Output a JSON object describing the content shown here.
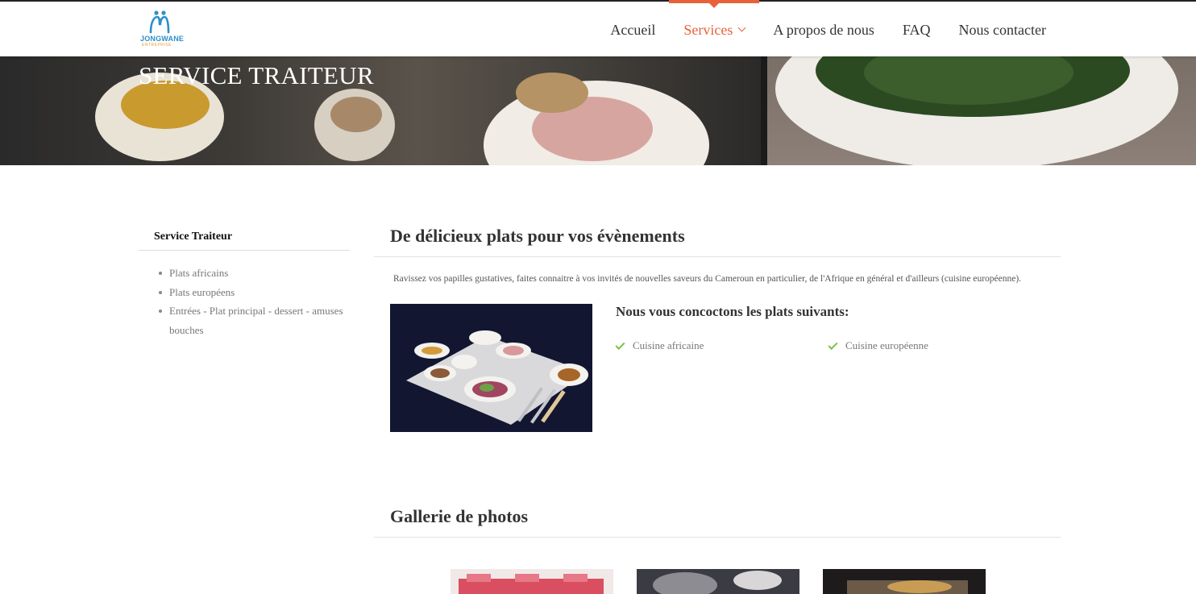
{
  "brand": {
    "name": "JONGWANE",
    "tagline": "ENTREPRISE",
    "primary_color": "#2c8fc9",
    "accent_color": "#e8613a"
  },
  "nav": {
    "items": [
      {
        "label": "Accueil",
        "active": false
      },
      {
        "label": "Services",
        "active": true,
        "has_dropdown": true
      },
      {
        "label": "A propos de nous",
        "active": false
      },
      {
        "label": "FAQ",
        "active": false
      },
      {
        "label": "Nous contacter",
        "active": false
      }
    ]
  },
  "banner": {
    "title": "SERVICE TRAITEUR"
  },
  "sidebar": {
    "title": "Service Traiteur",
    "items": [
      "Plats africains",
      "Plats européens",
      "Entrées - Plat principal - dessert - amuses bouches"
    ]
  },
  "main": {
    "heading": "De délicieux plats pour vos évènements",
    "intro": "Ravissez vos papilles gustatives, faites connaitre à vos invités de nouvelles saveurs du Cameroun en particulier, de l'Afrique en général et d'ailleurs (cuisine européenne).",
    "sub_heading": "Nous vous concoctons les plats suivants:",
    "checks": [
      "Cuisine africaine",
      "Cuisine européenne"
    ],
    "check_color": "#7cbf45"
  },
  "gallery": {
    "heading": "Gallerie de photos"
  }
}
